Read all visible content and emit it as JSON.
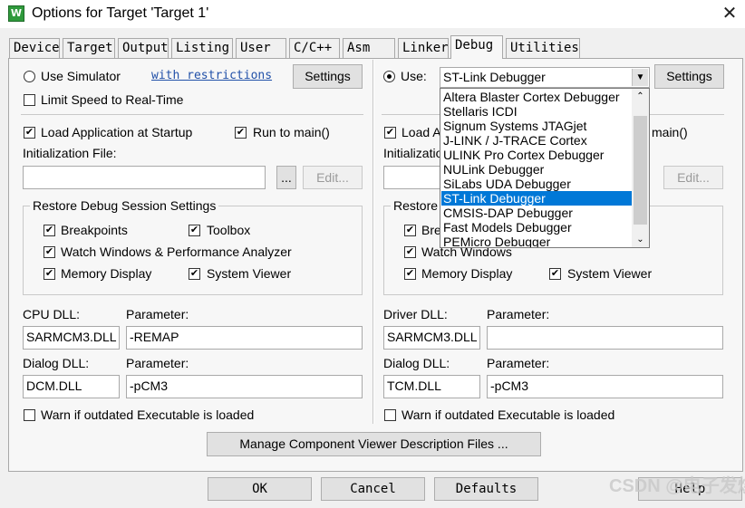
{
  "window": {
    "title": "Options for Target 'Target 1'",
    "app_icon": "W",
    "close_glyph": "✕"
  },
  "tabs": [
    "Device",
    "Target",
    "Output",
    "Listing",
    "User",
    "C/C++",
    "Asm",
    "Linker",
    "Debug",
    "Utilities"
  ],
  "active_tab": "Debug",
  "left": {
    "use_simulator": "Use Simulator",
    "with_restrictions": "with restrictions",
    "settings": "Settings",
    "limit_speed": "Limit Speed to Real-Time",
    "load_app": "Load Application at Startup",
    "run_to_main": "Run to main()",
    "init_file_label": "Initialization File:",
    "browse": "...",
    "edit": "Edit...",
    "restore_title": "Restore Debug Session Settings",
    "breakpoints": "Breakpoints",
    "toolbox": "Toolbox",
    "watch": "Watch Windows & Performance Analyzer",
    "memory": "Memory Display",
    "system_viewer": "System Viewer",
    "cpu_dll_label": "CPU DLL:",
    "param_label": "Parameter:",
    "cpu_dll": "SARMCM3.DLL",
    "cpu_param": "-REMAP",
    "dialog_dll_label": "Dialog DLL:",
    "dialog_dll": "DCM.DLL",
    "dialog_param": "-pCM3",
    "warn": "Warn if outdated Executable is loaded"
  },
  "right": {
    "use": "Use:",
    "debugger": "ST-Link Debugger",
    "settings": "Settings",
    "load_app_partial": "Load A",
    "run_to_main_partial": "main()",
    "init_partial": "Initializatio",
    "browse": "...",
    "edit": "Edit...",
    "restore_partial": "Restore",
    "bre_partial": "Bre",
    "watch_partial": "Watch Windows",
    "memory": "Memory Display",
    "system_viewer": "System Viewer",
    "driver_dll_label": "Driver DLL:",
    "param_label": "Parameter:",
    "driver_dll": "SARMCM3.DLL",
    "driver_param": "",
    "dialog_dll_label": "Dialog DLL:",
    "dialog_dll": "TCM.DLL",
    "dialog_param": "-pCM3",
    "warn": "Warn if outdated Executable is loaded"
  },
  "debugger_options": [
    "Altera Blaster Cortex Debugger",
    "Stellaris ICDI",
    "Signum Systems JTAGjet",
    "J-LINK / J-TRACE Cortex",
    "ULINK Pro Cortex Debugger",
    "NULink Debugger",
    "SiLabs UDA Debugger",
    "ST-Link Debugger",
    "CMSIS-DAP Debugger",
    "Fast Models Debugger",
    "PEMicro Debugger"
  ],
  "selected_debugger_index": 7,
  "manage_btn": "Manage Component Viewer Description Files ...",
  "buttons": {
    "ok": "OK",
    "cancel": "Cancel",
    "defaults": "Defaults",
    "help": "Help"
  },
  "watermark": "CSDN @电子发烧友"
}
